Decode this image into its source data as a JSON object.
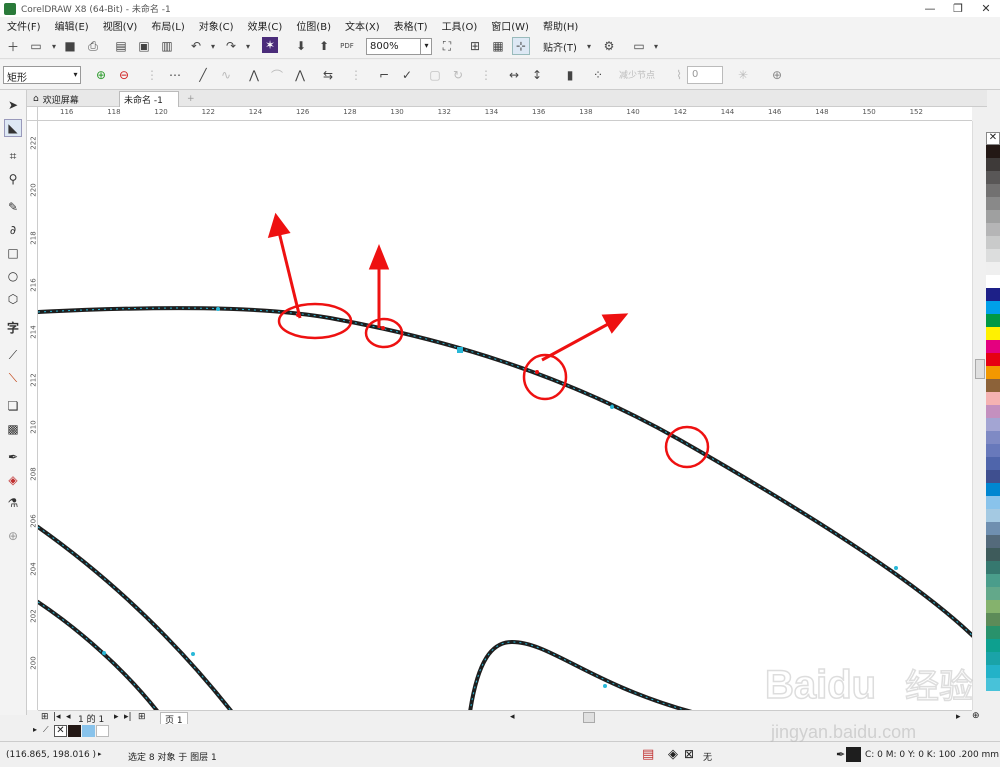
{
  "window": {
    "title": "CorelDRAW X8 (64-Bit) - 未命名 -1",
    "min": "—",
    "restore": "❐",
    "close": "✕"
  },
  "menu": [
    "文件(F)",
    "编辑(E)",
    "视图(V)",
    "布局(L)",
    "对象(C)",
    "效果(C)",
    "位图(B)",
    "文本(X)",
    "表格(T)",
    "工具(O)",
    "窗口(W)",
    "帮助(H)"
  ],
  "toolbar": {
    "zoom": "800%",
    "snap": "贴齐(T)",
    "pdf": "PDF"
  },
  "property_bar": {
    "shape_select": "矩形",
    "reduce_nodes": "减少节点",
    "node_value": "0"
  },
  "tabs": {
    "home": "欢迎屏幕",
    "doc": "未命名 -1",
    "add": "+"
  },
  "ruler": {
    "h": [
      "116",
      "118",
      "120",
      "122",
      "124",
      "126",
      "128",
      "130",
      "132",
      "134",
      "136",
      "138",
      "140",
      "142",
      "144",
      "146",
      "148",
      "150",
      "152"
    ],
    "v": [
      "222",
      "220",
      "218",
      "216",
      "214",
      "212",
      "210",
      "208",
      "206",
      "204",
      "202",
      "200"
    ]
  },
  "pagenav": {
    "page_count": "1 的 1",
    "page_tab": "页 1"
  },
  "status": {
    "coords": "(116.865, 198.016 )",
    "selection": "选定 8 对象 于 图层 1",
    "fill": "无",
    "outline": "C: 0 M: 0 Y: 0 K: 100 .200 mm"
  },
  "watermark": {
    "brand": "Baidu",
    "jingyan": "经验",
    "url": "jingyan.baidu.com"
  },
  "colors": {
    "accent": "#2a7a3a",
    "annotation": "#ee1111",
    "curve": "#1e1e1e",
    "node": "#29b8d8"
  },
  "palette": [
    "#231815",
    "#3e3a39",
    "#595757",
    "#727171",
    "#898989",
    "#9fa0a0",
    "#b5b5b6",
    "#c9caca",
    "#dcdddd",
    "#efefef",
    "#ffffff",
    "#1d2088",
    "#00a0e9",
    "#009944",
    "#fff100",
    "#e4007f",
    "#e60012",
    "#f39800",
    "#8c6239",
    "#f5b2b2",
    "#c490bf",
    "#a3a5d3",
    "#7f8ac4",
    "#6879bb",
    "#4f65ab",
    "#3f4f8f",
    "#0086d1",
    "#89c3eb",
    "#a4c9e2",
    "#6f8fb0",
    "#546a7b",
    "#3e5b5b",
    "#36786f",
    "#4a9d8b",
    "#63a88a",
    "#85b26d",
    "#5d8b58",
    "#29926b",
    "#0da08f",
    "#1aa3a8",
    "#23b2c8",
    "#48c2d9"
  ],
  "icons": [
    "pointer-icon",
    "shape-icon",
    "crop-icon",
    "zoom-icon",
    "freehand-icon",
    "artistic-media-icon",
    "rectangle-icon",
    "ellipse-icon",
    "polygon-icon",
    "text-icon",
    "parallel-dimension-icon",
    "connector-icon",
    "drop-shadow-icon",
    "transparency-icon",
    "eyedropper-icon",
    "interactive-fill-icon",
    "smart-fill-icon",
    "add-tool-icon"
  ]
}
